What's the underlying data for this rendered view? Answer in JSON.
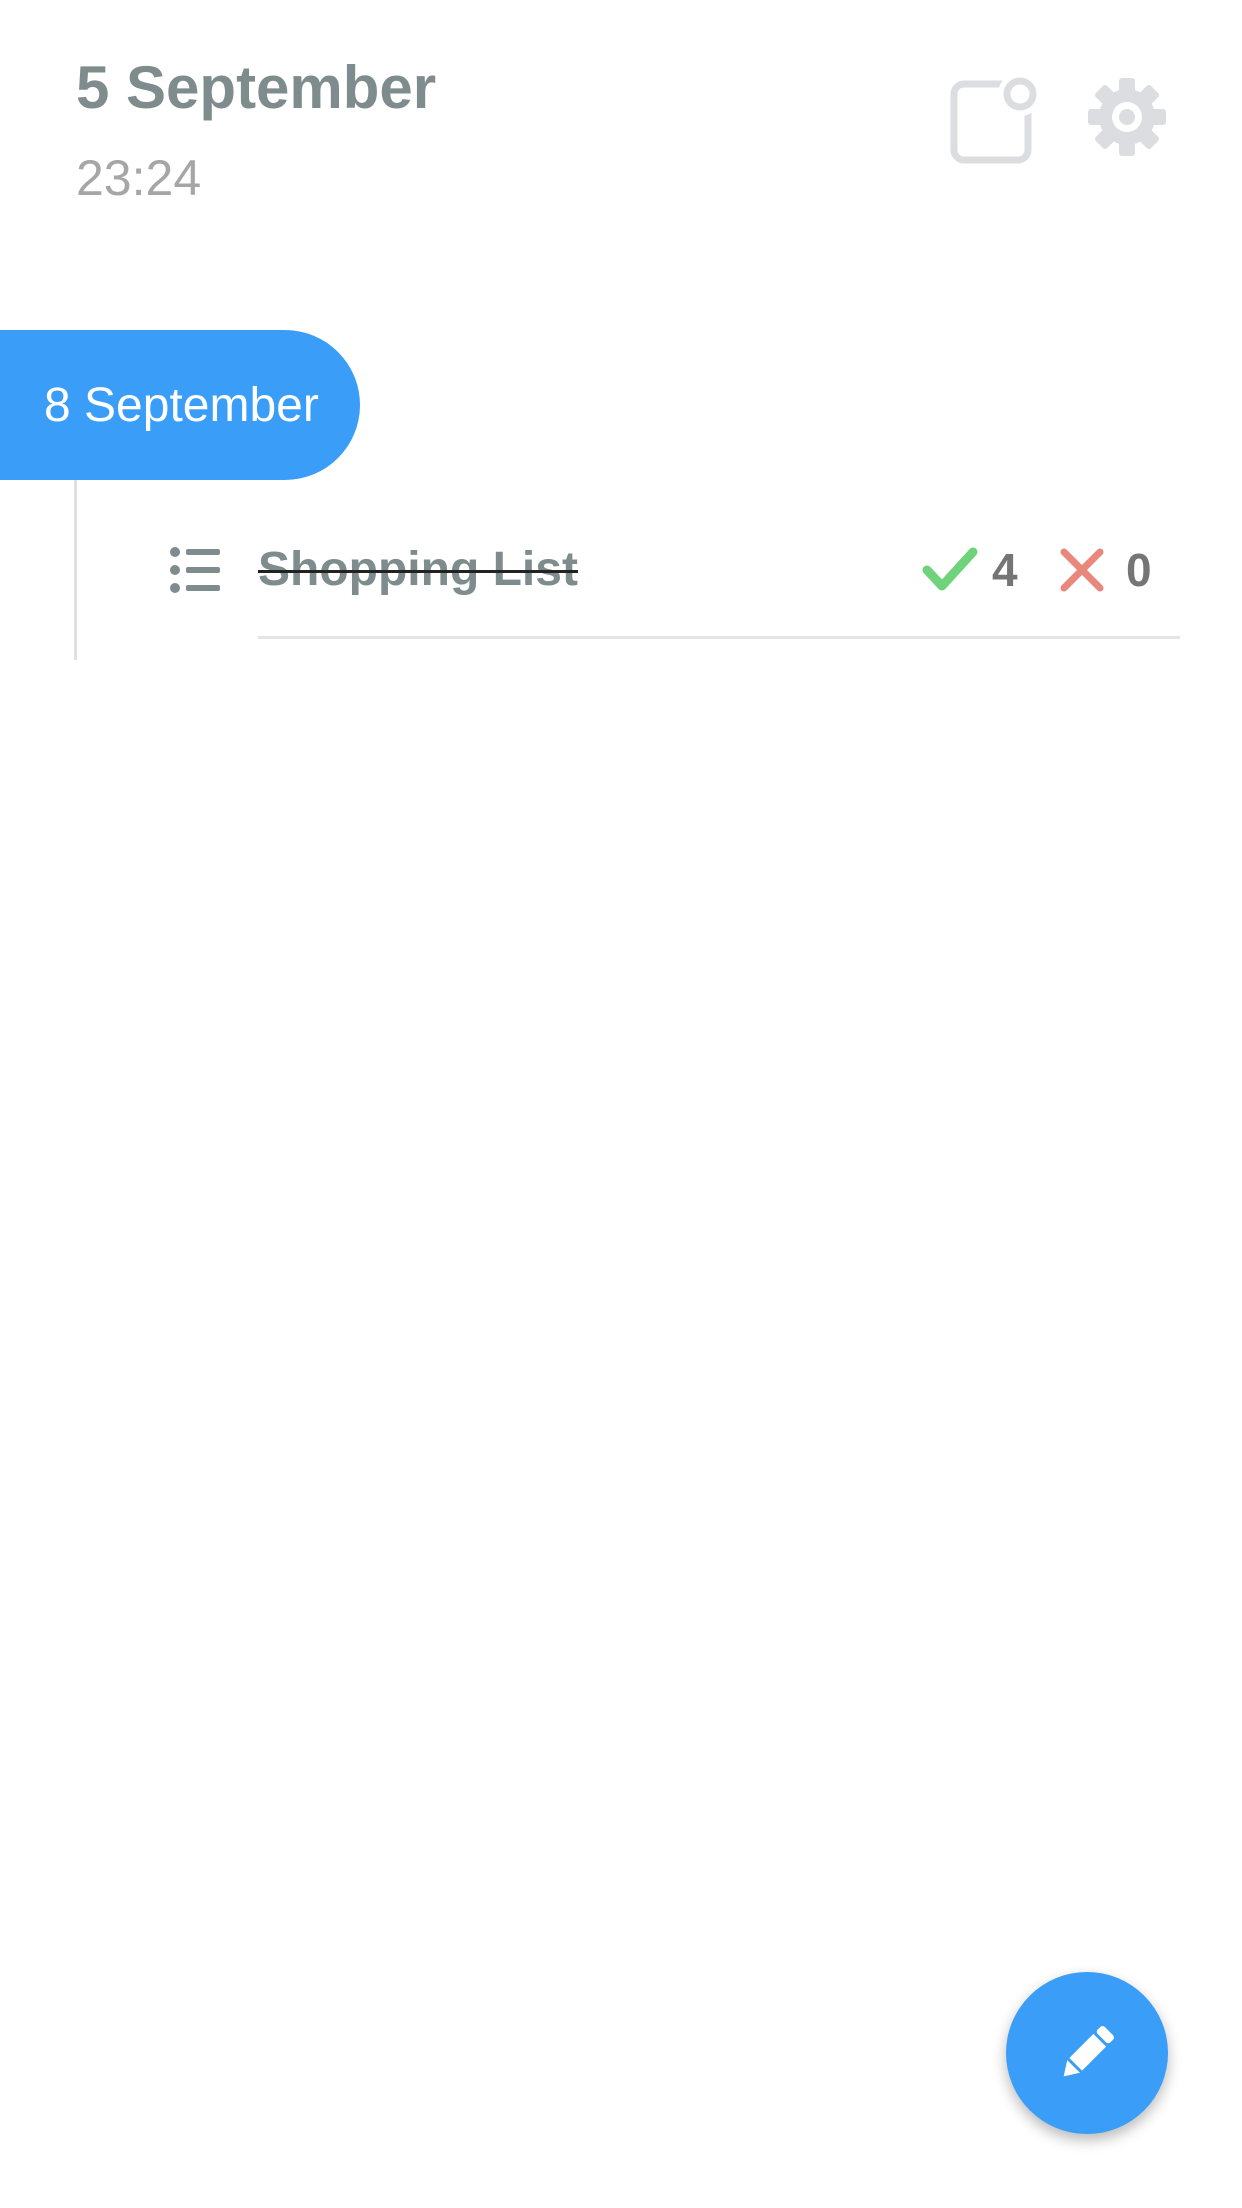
{
  "header": {
    "date": "5 September",
    "time": "23:24",
    "notes_icon": "note-badge-icon",
    "settings_icon": "gear-icon"
  },
  "timeline": {
    "section_label": "8 September",
    "items": [
      {
        "icon": "list-icon",
        "title": "Shopping List",
        "completed": true,
        "done_count": "4",
        "cancelled_count": "0"
      }
    ]
  },
  "fab": {
    "icon": "pencil-icon"
  },
  "colors": {
    "accent": "#3a9df8",
    "title_gray": "#7f8c8d",
    "time_gray": "#a6a6a6",
    "check_green": "#6fd37c",
    "cross_red": "#e8877c"
  }
}
